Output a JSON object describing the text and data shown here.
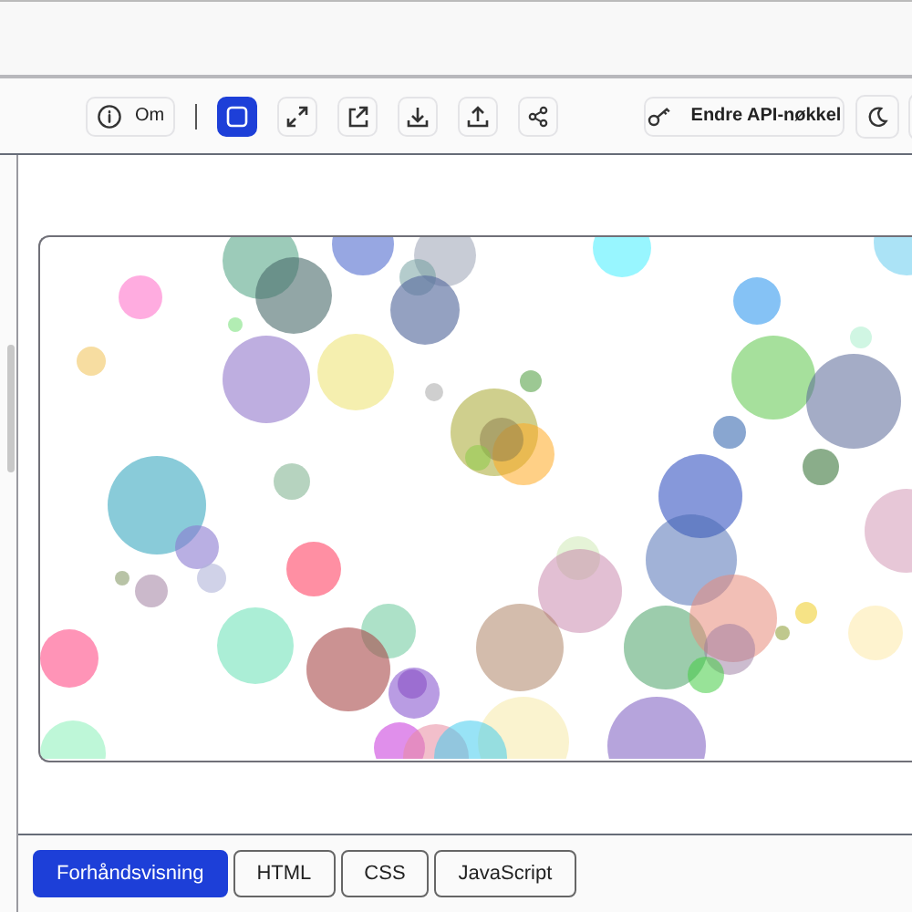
{
  "toolbar": {
    "about_button": {
      "label": "Om"
    },
    "frame_toggle": {
      "on": true
    },
    "api_key_button": {
      "label": "Endre API-nøkkel"
    }
  },
  "tabs": [
    {
      "label": "Forhåndsvisning",
      "selected": true
    },
    {
      "label": "HTML",
      "selected": false
    },
    {
      "label": "CSS",
      "selected": false
    },
    {
      "label": "JavaScript",
      "selected": false
    }
  ]
}
